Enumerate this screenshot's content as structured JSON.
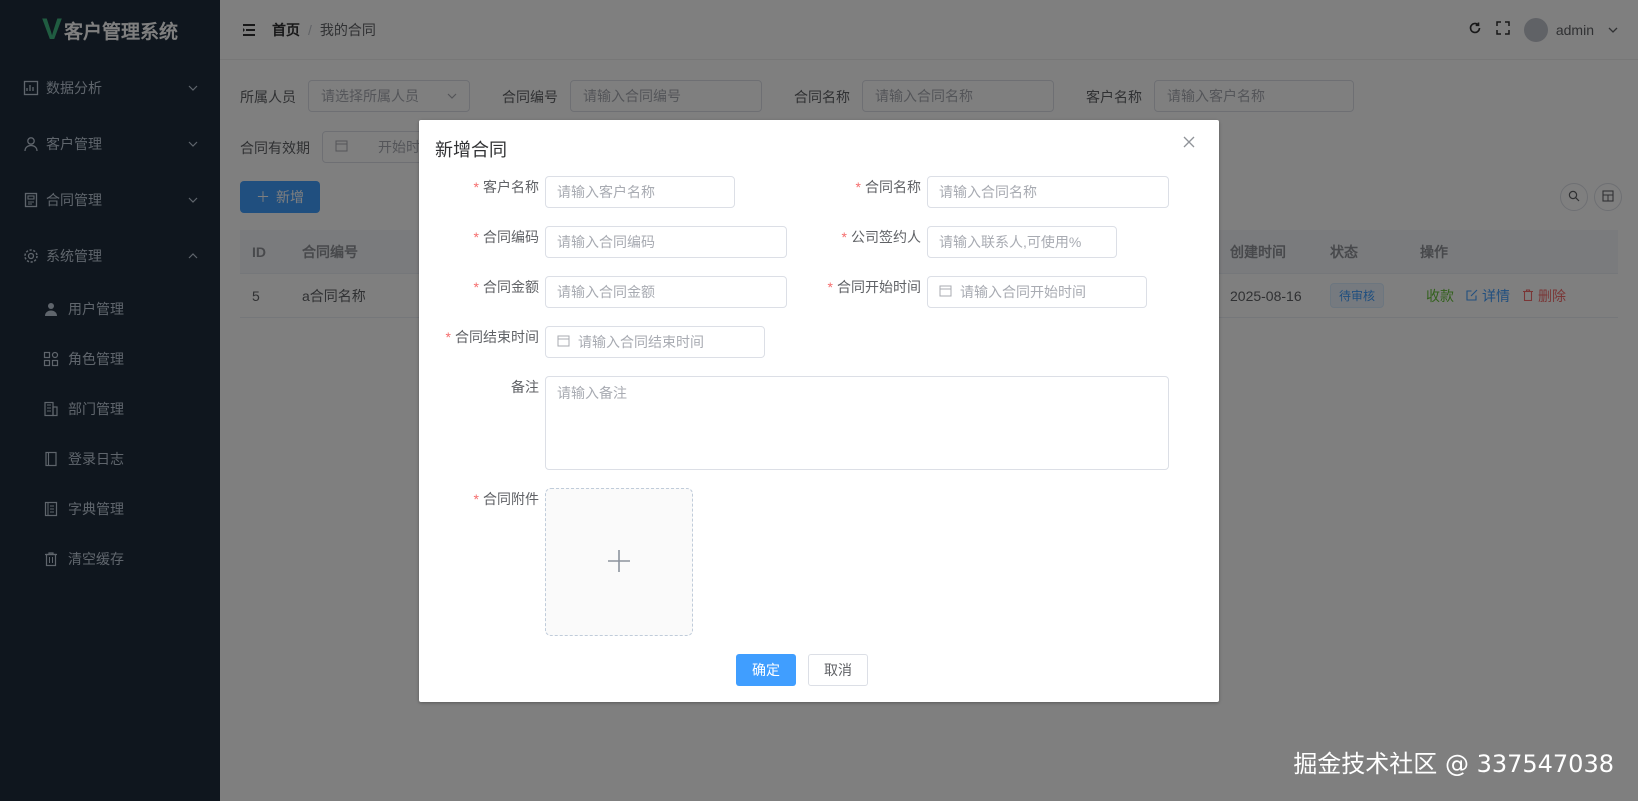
{
  "app": {
    "logo_letter": "V",
    "title": "客户管理系统"
  },
  "sidebar": {
    "items": [
      {
        "label": "数据分析",
        "icon": "chart-icon"
      },
      {
        "label": "客户管理",
        "icon": "user-icon"
      },
      {
        "label": "合同管理",
        "icon": "contract-icon"
      },
      {
        "label": "系统管理",
        "icon": "gear-icon"
      }
    ],
    "sub_items": [
      {
        "label": "用户管理",
        "icon": "person-icon"
      },
      {
        "label": "角色管理",
        "icon": "role-icon"
      },
      {
        "label": "部门管理",
        "icon": "building-icon"
      },
      {
        "label": "登录日志",
        "icon": "log-icon"
      },
      {
        "label": "字典管理",
        "icon": "dictionary-icon"
      },
      {
        "label": "清空缓存",
        "icon": "trash-icon"
      }
    ]
  },
  "header": {
    "breadcrumb_home": "首页",
    "breadcrumb_sep": "/",
    "breadcrumb_current": "我的合同",
    "username": "admin"
  },
  "filters": {
    "owner_label": "所属人员",
    "owner_placeholder": "请选择所属人员",
    "code_label": "合同编号",
    "code_placeholder": "请输入合同编号",
    "name_label": "合同名称",
    "name_placeholder": "请输入合同名称",
    "customer_label": "客户名称",
    "customer_placeholder": "请输入客户名称",
    "validity_label": "合同有效期",
    "validity_start": "开始时"
  },
  "toolbar": {
    "add_label": "新增"
  },
  "table": {
    "headers": {
      "id": "ID",
      "code": "合同编号",
      "created": "创建时间",
      "status": "状态",
      "ops": "操作"
    },
    "rows": [
      {
        "id": "5",
        "code": "a合同名称",
        "created": "2025-08-16",
        "status": "待审核",
        "op_collect": "收款",
        "op_detail": "详情",
        "op_delete": "删除"
      }
    ]
  },
  "dialog": {
    "title": "新增合同",
    "fields": {
      "customer_name": {
        "label": "客户名称",
        "placeholder": "请输入客户名称"
      },
      "contract_name": {
        "label": "合同名称",
        "placeholder": "请输入合同名称"
      },
      "contract_code": {
        "label": "合同编码",
        "placeholder": "请输入合同编码"
      },
      "signer": {
        "label": "公司签约人",
        "placeholder": "请输入联系人,可使用%"
      },
      "amount": {
        "label": "合同金额",
        "placeholder": "请输入合同金额"
      },
      "start_time": {
        "label": "合同开始时间",
        "placeholder": "请输入合同开始时间"
      },
      "end_time": {
        "label": "合同结束时间",
        "placeholder": "请输入合同结束时间"
      },
      "remark": {
        "label": "备注",
        "placeholder": "请输入备注"
      },
      "attachment": {
        "label": "合同附件"
      }
    },
    "required_mark": "*",
    "confirm_label": "确定",
    "cancel_label": "取消"
  },
  "watermark": "掘金技术社区 @ 337547038",
  "colors": {
    "primary": "#409eff",
    "sidebar_bg": "#1f2d3d",
    "danger": "#f56c6c",
    "success": "#67c23a",
    "logo": "#41b883"
  }
}
